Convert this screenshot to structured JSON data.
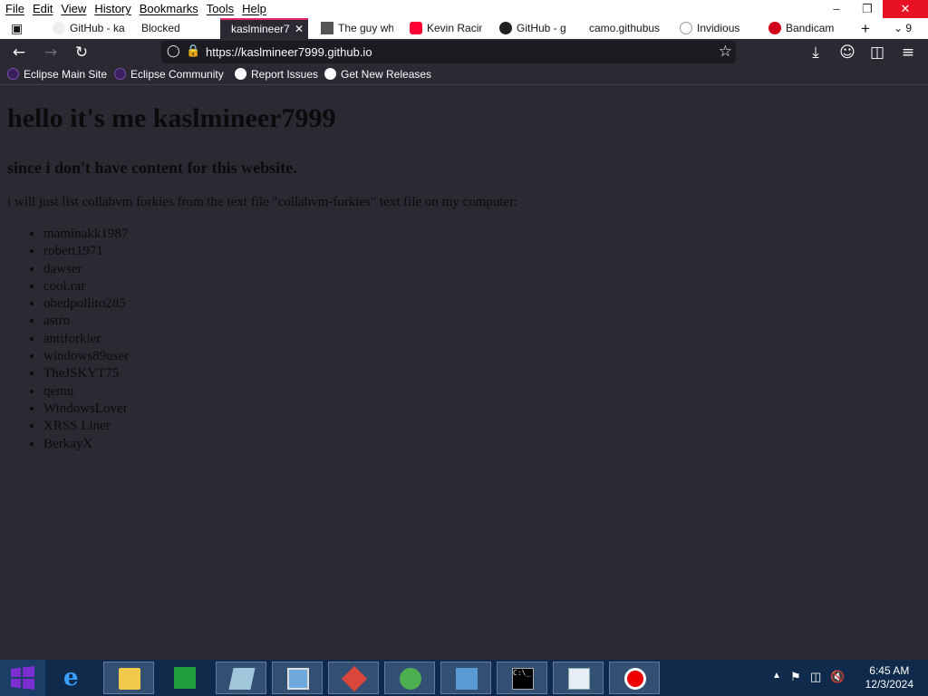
{
  "menu": {
    "items": [
      "File",
      "Edit",
      "View",
      "History",
      "Bookmarks",
      "Tools",
      "Help"
    ]
  },
  "tabs": [
    {
      "label": "GitHub - ka"
    },
    {
      "label": "Blocked"
    },
    {
      "label": "kaslmineer7"
    },
    {
      "label": "The guy wh"
    },
    {
      "label": "Kevin Racin"
    },
    {
      "label": "GitHub - g"
    },
    {
      "label": "camo.githubus"
    },
    {
      "label": "Invidious"
    },
    {
      "label": "Bandicam"
    }
  ],
  "tab_overflow_count": "9",
  "address": {
    "url": "https://kaslmineer7999.github.io"
  },
  "bookmarks": [
    {
      "label": "Eclipse Main Site"
    },
    {
      "label": "Eclipse Community"
    },
    {
      "label": "Report Issues"
    },
    {
      "label": "Get New Releases"
    }
  ],
  "page": {
    "heading": "hello it's me kaslmineer7999",
    "subheading": "since i don't have content for this website.",
    "intro": "i will just list collabvm forkies from the text file \"collabvm-forkies\" text file on my computer:",
    "forkies": [
      "maminakk1987",
      "robert1971",
      "dawser",
      "cool.rar",
      "obedpollito285",
      "astro",
      "antiforkier",
      "windows89user",
      "TheJSKYT75",
      "qemu",
      "WindowsLover",
      "XRSS Liner",
      "BerkayX"
    ]
  },
  "taskbar": {
    "time": "6:45 AM",
    "date": "12/3/2024"
  },
  "colors": {
    "tab_accent": "#e5266b",
    "browser_bg": "#2b2a33",
    "taskbar_bg": "#0f2a4a",
    "close_red": "#e81123"
  }
}
